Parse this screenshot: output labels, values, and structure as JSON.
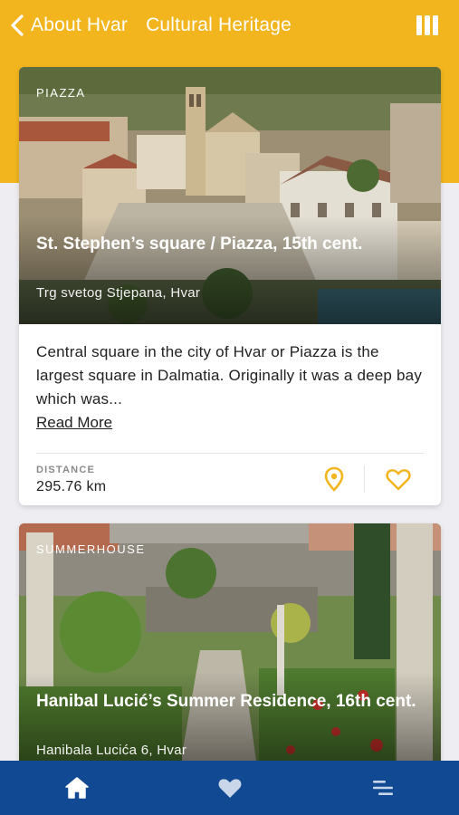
{
  "header": {
    "back_label": "About Hvar",
    "title": "Cultural Heritage",
    "icons": {
      "back": "chevron-left-icon",
      "map": "map-icon"
    }
  },
  "colors": {
    "accent": "#f2b51d",
    "tabbar": "#114a93"
  },
  "cards": [
    {
      "category": "PIAZZA",
      "title": "St. Stephen’s square / Piazza, 15th cent.",
      "address": "Trg svetog Stjepana, Hvar",
      "description": "Central square in the city of Hvar or Piazza is the largest square in Dalmatia. Originally it was a deep bay which was...",
      "read_more": "Read More",
      "distance_label": "DISTANCE",
      "distance_value": "295.76 km"
    },
    {
      "category": "SUMMERHOUSE",
      "title": "Hanibal Lucić’s Summer Residence, 16th cent.",
      "address": "Hanibala Lucića 6, Hvar"
    }
  ],
  "tabbar": {
    "tabs": [
      {
        "icon": "home-icon",
        "active": true
      },
      {
        "icon": "heart-icon",
        "active": false
      },
      {
        "icon": "menu-icon",
        "active": false
      }
    ]
  }
}
